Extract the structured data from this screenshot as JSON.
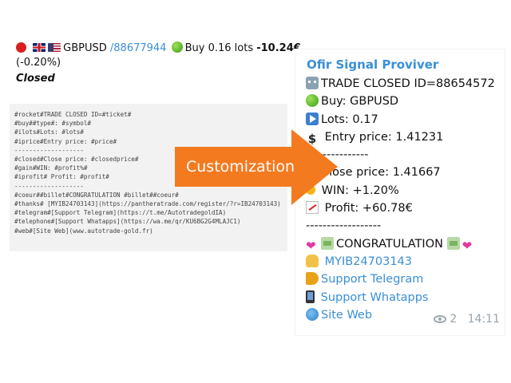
{
  "trade_header": {
    "pair": "GBPUSD",
    "order_link": "/88677944",
    "action": "Buy 0.16 lots",
    "pnl": "-10.24€",
    "pnl_pct": "(-0.20%)",
    "status": "Closed",
    "status_icon": "red-circle-icon",
    "flags": [
      "uk-flag-icon",
      "us-flag-icon"
    ]
  },
  "template": {
    "lines": [
      "#rocket#TRADE CLOSED ID=#ticket#",
      "#buy##type#: #symbol#",
      "#ilots#Lots: #lots#",
      "#iprice#Entry price: #price#",
      "-------------------",
      "#closed#Close price: #closedprice#",
      "#gain#WIN: #profit%#",
      "#iprofit# Profit: #profit#",
      "-------------------",
      "#coeur##billet#CONGRATULATION #billet##coeur#",
      "#thanks# [MYIB24703143](https://pantheratrade.com/register/?r=IB24703143)",
      "#telegram#[Support Telegram](https://t.me/AutotradegoldIA)",
      "#telephone#[Support Whatapps](https://wa.me/qr/KU6BG2G4MLAJC1)",
      "#web#[Site Web](www.autotrade-gold.fr)"
    ]
  },
  "arrow": {
    "label": "Customization",
    "color": "#f47a20"
  },
  "message": {
    "channel": "Ofir Signal Proviver",
    "lines": [
      {
        "icon": "robot-icon",
        "text": "TRADE CLOSED ID=88654572"
      },
      {
        "icon": "green-apple-icon",
        "text": "Buy: GBPUSD"
      },
      {
        "icon": "play-button-icon",
        "text": "Lots: 0.17"
      },
      {
        "icon": "dollar-sign-icon",
        "text": " Entry price: 1.41231"
      },
      {
        "icon": "",
        "text": "---------------"
      },
      {
        "icon": "",
        "text": "Close price: 1.41667"
      },
      {
        "icon": "coin-icon",
        "text": " WIN: +1.20%"
      },
      {
        "icon": "chart-icon",
        "text": " Profit: +60.78€"
      },
      {
        "icon": "",
        "text": "------------------"
      },
      {
        "icon": "heart-money-icon",
        "text": "CONGRATULATION"
      },
      {
        "icon": "pray-icon",
        "text": " MYIB24703143"
      },
      {
        "icon": "megaphone-icon",
        "text": "Support Telegram"
      },
      {
        "icon": "phone-icon",
        "text": " Support Whatapps"
      },
      {
        "icon": "globe-icon",
        "text": "Site Web"
      }
    ],
    "views": "2",
    "time": "14:11"
  }
}
